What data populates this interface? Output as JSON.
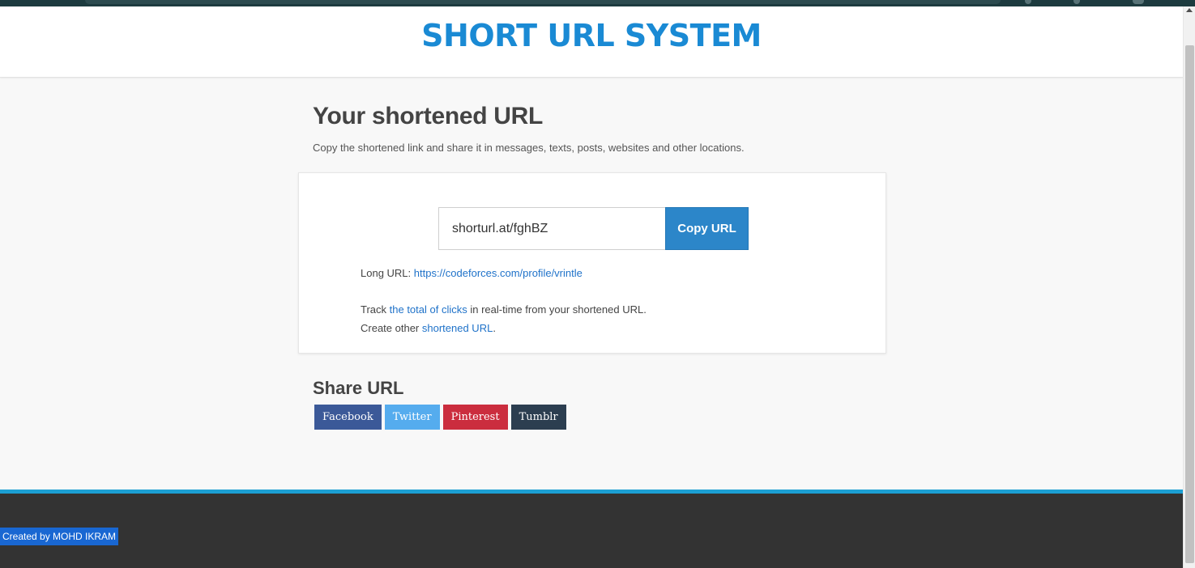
{
  "colors": {
    "brand_title": "#1a8ad4",
    "copy_button": "#2c86c9",
    "link": "#1f72c9",
    "footer_bg": "#333333",
    "footer_accent": "#1c9fd3",
    "facebook": "#3b5998",
    "twitter": "#55acee",
    "pinterest": "#cb2d3e",
    "tumblr": "#2c3e50"
  },
  "header": {
    "site_title": "SHORT URL SYSTEM"
  },
  "main": {
    "heading": "Your shortened URL",
    "subtitle": "Copy the shortened link and share it in messages, texts, posts, websites and other locations."
  },
  "card": {
    "short_url_value": "shorturl.at/fghBZ",
    "copy_label": "Copy URL",
    "long_url_label": "Long URL: ",
    "long_url_link": "https://codeforces.com/profile/vrintle",
    "track_prefix": "Track ",
    "track_link": "the total of clicks",
    "track_suffix": " in real-time from your shortened URL.",
    "create_prefix": "Create other ",
    "create_link": "shortened URL",
    "create_suffix": "."
  },
  "share": {
    "heading": "Share URL",
    "buttons": [
      {
        "label": "Facebook",
        "color": "#3b5998"
      },
      {
        "label": "Twitter",
        "color": "#55acee"
      },
      {
        "label": "Pinterest",
        "color": "#cb2d3e"
      },
      {
        "label": "Tumblr",
        "color": "#2c3e50"
      }
    ]
  },
  "footer": {
    "credit": "Created by MOHD IKRAM"
  }
}
